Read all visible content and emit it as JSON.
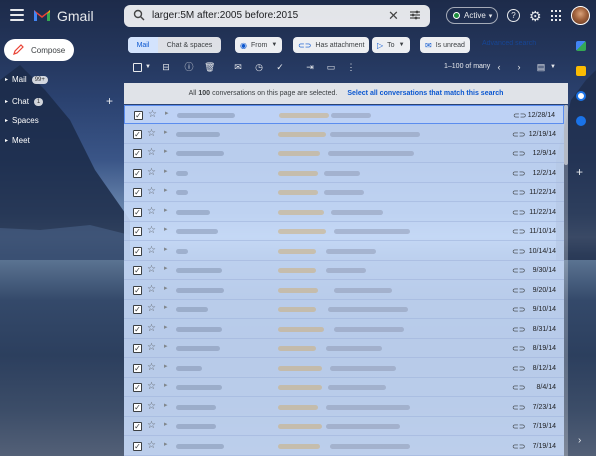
{
  "app": {
    "name": "Gmail"
  },
  "search": {
    "query": "larger:5M after:2005 before:2015"
  },
  "status": {
    "label": "Active"
  },
  "compose": {
    "label": "Compose"
  },
  "nav": {
    "mail": {
      "label": "Mail",
      "badge": "99+"
    },
    "chat": {
      "label": "Chat",
      "badge": "1"
    },
    "spaces": {
      "label": "Spaces"
    },
    "meet": {
      "label": "Meet"
    }
  },
  "filters": {
    "tab_mail": "Mail",
    "tab_chat": "Chat & spaces",
    "from": "From",
    "has_attachment": "Has attachment",
    "to": "To",
    "is_unread": "Is unread",
    "advanced_search": "Advanced search"
  },
  "toolbar": {
    "page_info": "1–100 of many"
  },
  "banner": {
    "prefix": "All",
    "count": "100",
    "suffix": "conversations on this page are selected.",
    "link": "Select all conversations that match this search"
  },
  "emails": [
    {
      "date": "12/28/14"
    },
    {
      "date": "12/19/14"
    },
    {
      "date": "12/9/14"
    },
    {
      "date": "12/2/14"
    },
    {
      "date": "11/22/14"
    },
    {
      "date": "11/22/14"
    },
    {
      "date": "11/10/14"
    },
    {
      "date": "10/14/14"
    },
    {
      "date": "9/30/14"
    },
    {
      "date": "9/20/14"
    },
    {
      "date": "9/10/14"
    },
    {
      "date": "8/31/14"
    },
    {
      "date": "8/19/14"
    },
    {
      "date": "8/12/14"
    },
    {
      "date": "8/4/14"
    },
    {
      "date": "7/23/14"
    },
    {
      "date": "7/19/14"
    },
    {
      "date": "7/19/14"
    }
  ],
  "colors": {
    "accent": "#0b57d0",
    "selected_row": "#c8daf8",
    "active_dot": "#1e8e3e"
  }
}
